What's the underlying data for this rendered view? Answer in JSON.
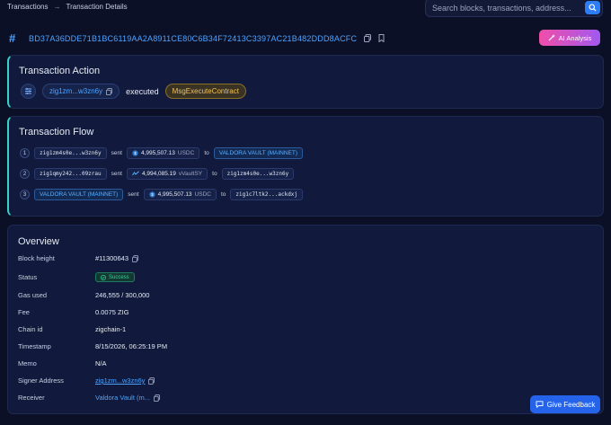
{
  "breadcrumb": {
    "root": "Transactions",
    "separator": "→",
    "current": "Transaction Details"
  },
  "search": {
    "placeholder": "Search blocks, transactions, address..."
  },
  "tx": {
    "hash": "BD37A36DDE71B1BC6119AA2A8911CE80C6B34F72413C3397AC21B482DDD8ACFC"
  },
  "ai_button": {
    "label": "AI Analysis"
  },
  "action": {
    "title": "Transaction Action",
    "signer": "zig1zm...w3zn6y",
    "verb": "executed",
    "message": "MsgExecuteContract"
  },
  "flow": {
    "title": "Transaction Flow",
    "sent_word": "sent",
    "to_word": "to",
    "steps": [
      {
        "num": "1",
        "from": "zig1zm4s0e...w3zn6y",
        "amount": "4,995,507.13",
        "token": "USDC",
        "to": "VALDORA VAULT (MAINNET)"
      },
      {
        "num": "2",
        "from": "zig1qmy242...09zrau",
        "amount": "4,994,085.19",
        "token": "vVaultSY",
        "to": "zig1zm4s0e...w3zn6y"
      },
      {
        "num": "3",
        "from": "VALDORA VAULT (MAINNET)",
        "amount": "4,995,507.13",
        "token": "USDC",
        "to": "zig1c7ltk2...ackdxj"
      }
    ]
  },
  "overview": {
    "title": "Overview",
    "block_height": {
      "label": "Block height",
      "value": "#11300643"
    },
    "status": {
      "label": "Status",
      "value": "Success"
    },
    "gas_used": {
      "label": "Gas used",
      "value": "246,555 / 300,000"
    },
    "fee": {
      "label": "Fee",
      "value": "0.0075 ZIG"
    },
    "chain_id": {
      "label": "Chain id",
      "value": "zigchain-1"
    },
    "timestamp": {
      "label": "Timestamp",
      "value": "8/15/2026, 06:25:19 PM"
    },
    "memo": {
      "label": "Memo",
      "value": "N/A"
    },
    "signer": {
      "label": "Signer Address",
      "value": "zig1zm...w3zn6y"
    },
    "receiver": {
      "label": "Receiver",
      "value": "Valdora Vault (m..."
    }
  },
  "feedback_button": {
    "label": "Give Feedback"
  },
  "colors": {
    "background": "#0b1026",
    "panel": "#111a3c",
    "accent_blue": "#4ea3ff",
    "flow_accent": "#3ad1c7",
    "success": "#35d39a",
    "msg_gold": "#f2c35a"
  }
}
